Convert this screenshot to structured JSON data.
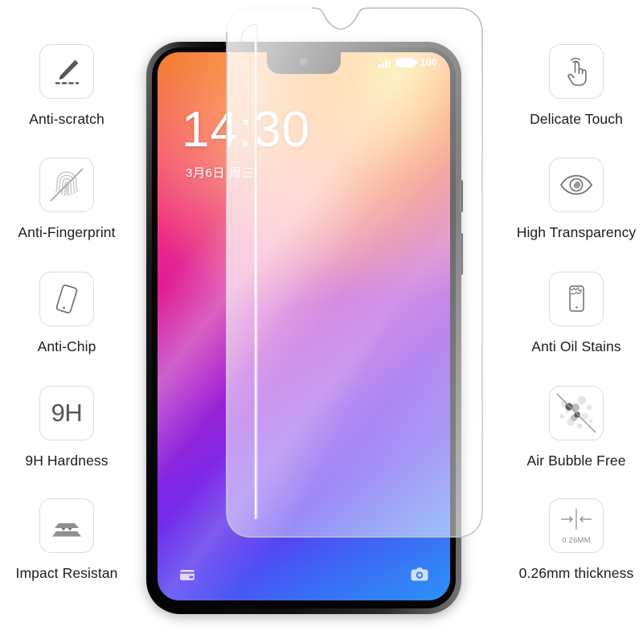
{
  "product": {
    "type": "tempered-glass-screen-protector",
    "features_left": [
      {
        "id": "anti-scratch",
        "icon": "pen-scratch-icon",
        "label": "Anti-scratch",
        "clipped": false
      },
      {
        "id": "anti-fingerprint",
        "icon": "fingerprint-icon",
        "label": "Anti-Fingerprint",
        "clipped": true
      },
      {
        "id": "anti-chip",
        "icon": "tilted-phone-icon",
        "label": "Anti-Chip",
        "clipped": false
      },
      {
        "id": "nine-h-hardness",
        "icon": "hardness-9h-icon",
        "label": "9H Hardness",
        "clipped": false,
        "icon_text": "9H"
      },
      {
        "id": "impact-resistant",
        "icon": "impact-layers-icon",
        "label": "Impact Resistan",
        "clipped": true
      }
    ],
    "features_right": [
      {
        "id": "delicate-touch",
        "icon": "pointing-hand-icon",
        "label": "Delicate Touch"
      },
      {
        "id": "high-transparency",
        "icon": "eye-icon",
        "label": "High Transparency"
      },
      {
        "id": "anti-oil-stains",
        "icon": "phone-oil-stain-icon",
        "label": "Anti Oil Stains"
      },
      {
        "id": "air-bubble-free",
        "icon": "bubbles-crossed-icon",
        "label": "Air Bubble Free"
      },
      {
        "id": "thickness",
        "icon": "thickness-arrows-icon",
        "label": "0.26mm thickness",
        "icon_text": "0.26MM"
      }
    ]
  },
  "phone": {
    "status_bar": {
      "signal": "signal-bars-icon",
      "battery_icon": "battery-full-icon",
      "battery_percent": "100"
    },
    "lock_screen": {
      "time": "14:30",
      "date": "3月6日 周三"
    },
    "dock": {
      "left": "wallet-icon",
      "right": "camera-icon"
    },
    "notch": "waterdrop-notch",
    "front_camera": "front-camera-icon"
  },
  "colors": {
    "icon_border": "#dcdcdc",
    "label_text": "#1c1c1c",
    "icon_gray": "#595959",
    "background": "#ffffff"
  }
}
